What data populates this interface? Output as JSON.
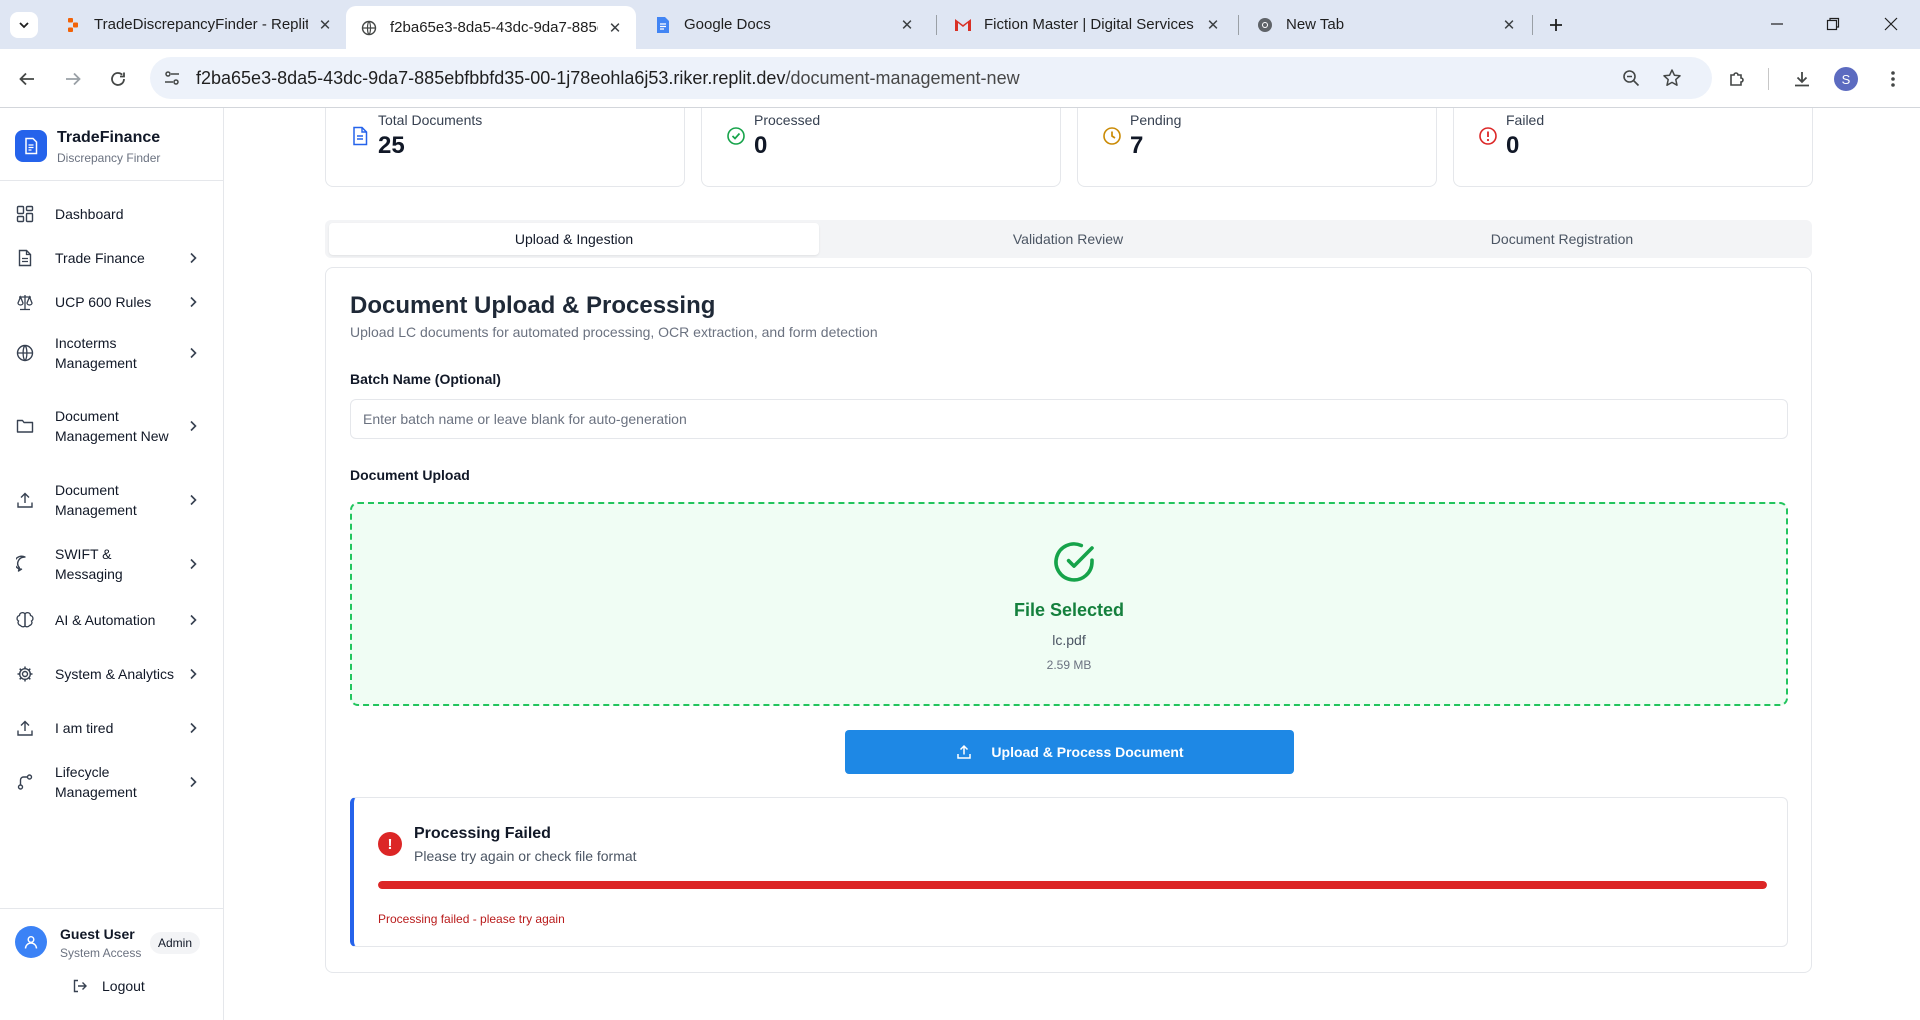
{
  "browser": {
    "tabs": [
      {
        "title": "TradeDiscrepancyFinder - Replit",
        "icon": "replit-icon"
      },
      {
        "title": "f2ba65e3-8da5-43dc-9da7-885ebfbbfd35",
        "icon": "globe-icon",
        "active": true
      },
      {
        "title": "Google Docs",
        "icon": "google-docs-icon"
      },
      {
        "title": "Fiction Master | Digital Services",
        "icon": "gmail-icon"
      },
      {
        "title": "New Tab",
        "icon": "chrome-icon"
      }
    ],
    "url_host": "f2ba65e3-8da5-43dc-9da7-885ebfbbfd35-00-1j78eohla6j53.riker.replit.dev",
    "url_path": "/document-management-new",
    "profile_initial": "S"
  },
  "brand": {
    "name": "TradeFinance",
    "subtitle": "Discrepancy Finder"
  },
  "sidebar": {
    "items": [
      {
        "label": "Dashboard",
        "icon": "dashboard-icon",
        "chevron": false
      },
      {
        "label": "Trade Finance",
        "icon": "document-icon",
        "chevron": true
      },
      {
        "label": "UCP 600 Rules",
        "icon": "scale-icon",
        "chevron": true
      },
      {
        "label": "Incoterms Management",
        "icon": "globe-icon",
        "chevron": true
      },
      {
        "label": "Document Management New",
        "icon": "folder-icon",
        "chevron": true
      },
      {
        "label": "Document Management",
        "icon": "upload-icon",
        "chevron": true
      },
      {
        "label": "SWIFT & Messaging",
        "icon": "message-icon",
        "chevron": true
      },
      {
        "label": "AI & Automation",
        "icon": "brain-icon",
        "chevron": true
      },
      {
        "label": "System & Analytics",
        "icon": "gear-icon",
        "chevron": true
      },
      {
        "label": "I am tired",
        "icon": "upload-icon",
        "chevron": true
      },
      {
        "label": "Lifecycle Management",
        "icon": "workflow-icon",
        "chevron": true
      }
    ]
  },
  "user": {
    "name": "Guest User",
    "role": "System Access",
    "badge": "Admin",
    "logout_label": "Logout"
  },
  "stats": [
    {
      "label": "Total Documents",
      "value": "25",
      "icon": "file-icon",
      "color": "#2563eb"
    },
    {
      "label": "Processed",
      "value": "0",
      "icon": "check-circle-icon",
      "color": "#16a34a"
    },
    {
      "label": "Pending",
      "value": "7",
      "icon": "clock-icon",
      "color": "#ca8a04"
    },
    {
      "label": "Failed",
      "value": "0",
      "icon": "alert-circle-icon",
      "color": "#dc2626"
    }
  ],
  "tabs": [
    {
      "label": "Upload & Ingestion",
      "selected": true
    },
    {
      "label": "Validation Review",
      "selected": false
    },
    {
      "label": "Document Registration",
      "selected": false
    }
  ],
  "upload": {
    "title": "Document Upload & Processing",
    "subtitle": "Upload LC documents for automated processing, OCR extraction, and form detection",
    "batch_label": "Batch Name (Optional)",
    "batch_value": "",
    "batch_placeholder": "Enter batch name or leave blank for auto-generation",
    "upload_label": "Document Upload",
    "file_status": "File Selected",
    "file_name": "lc.pdf",
    "file_size": "2.59 MB",
    "button_label": "Upload & Process Document"
  },
  "status": {
    "title": "Processing Failed",
    "subtitle": "Please try again or check file format",
    "progress": 1.0,
    "error": "Processing failed - please try again"
  },
  "colors": {
    "accent": "#2563eb",
    "button": "#1e88e5",
    "success": "#16a34a",
    "error": "#dc2626",
    "pending": "#ca8a04"
  }
}
